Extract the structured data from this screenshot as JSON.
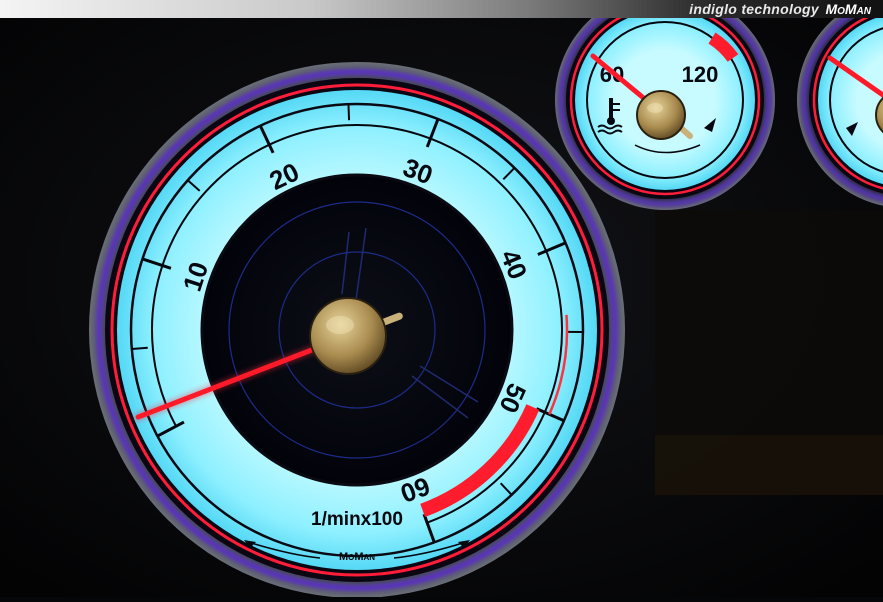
{
  "banner": {
    "text": "indiglo technology",
    "brand": "MoMan"
  },
  "tachometer": {
    "unit_label": "1/minx100",
    "brand_label": "MoMan",
    "scale": [
      {
        "label": "10",
        "value": 10
      },
      {
        "label": "20",
        "value": 20
      },
      {
        "label": "30",
        "value": 30
      },
      {
        "label": "40",
        "value": 40
      },
      {
        "label": "50",
        "value": 50
      },
      {
        "label": "60",
        "value": 60
      }
    ],
    "needle_value": 0,
    "redline_start": 50,
    "redline_end": 60
  },
  "temperature_gauge": {
    "scale": [
      {
        "label": "60",
        "value": 60
      },
      {
        "label": "120",
        "value": 120
      }
    ],
    "icon": "coolant-temperature-icon"
  },
  "colors": {
    "dial_glow": "#9ef4ff",
    "dial_face": "#7fe9ff",
    "needle": "#ff1a2a",
    "redline": "#ff1d2d",
    "hub": "#b59a5c",
    "bezel_blue": "#3a3aff"
  }
}
